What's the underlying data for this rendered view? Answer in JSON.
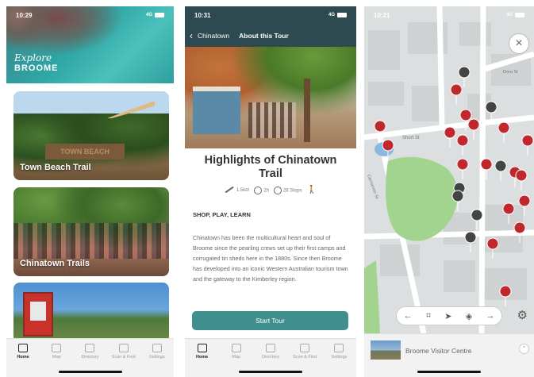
{
  "screen1": {
    "status": {
      "time": "10:29",
      "signal": "4G"
    },
    "logo": {
      "line1": "Explore",
      "line2": "BROOME"
    },
    "cards": [
      {
        "title": "Town Beach Trail",
        "sign": "TOWN BEACH"
      },
      {
        "title": "Chinatown Trails"
      },
      {
        "title": ""
      }
    ],
    "tabs": [
      {
        "label": "Home",
        "icon": "home-icon"
      },
      {
        "label": "Map",
        "icon": "map-icon"
      },
      {
        "label": "Directory",
        "icon": "directory-icon"
      },
      {
        "label": "Scan & Find",
        "icon": "scan-icon"
      },
      {
        "label": "Settings",
        "icon": "gear-icon"
      }
    ]
  },
  "screen2": {
    "status": {
      "time": "10:31",
      "signal": "4G"
    },
    "nav": {
      "back": "Chinatown",
      "current": "About this Tour"
    },
    "title": "Highlights of Chinatown Trail",
    "stats": {
      "distance": "1.5km",
      "duration": "2h",
      "stops": "28 Stops"
    },
    "subheading": "SHOP, PLAY, LEARN",
    "description": "Chinatown has been the multicultural heart and soul of Broome since the pearling crews set up their first camps and corrugated tin sheds here in the 1880s. Since then Broome has developed into an iconic Western Australian tourism town and the gateway to the Kimberley region.",
    "start_button": "Start Tour",
    "tabs": [
      {
        "label": "Home",
        "icon": "home-icon"
      },
      {
        "label": "Map",
        "icon": "map-icon"
      },
      {
        "label": "Directory",
        "icon": "directory-icon"
      },
      {
        "label": "Scan & Find",
        "icon": "scan-icon"
      },
      {
        "label": "Settings",
        "icon": "gear-icon"
      }
    ]
  },
  "screen3": {
    "status": {
      "time": "10:21",
      "signal": "4G"
    },
    "streets": [
      "Short St",
      "Carnarvon St",
      "Dora St"
    ],
    "close": "×",
    "toolbar": [
      "←",
      "⌗",
      "➤",
      "◈",
      "→"
    ],
    "visitor_centre": "Broome Visitor Centre",
    "chevron": "⌃"
  },
  "colors": {
    "teal": "#3f8f8f",
    "header": "#2c4a50",
    "pin": "#c0282e"
  }
}
